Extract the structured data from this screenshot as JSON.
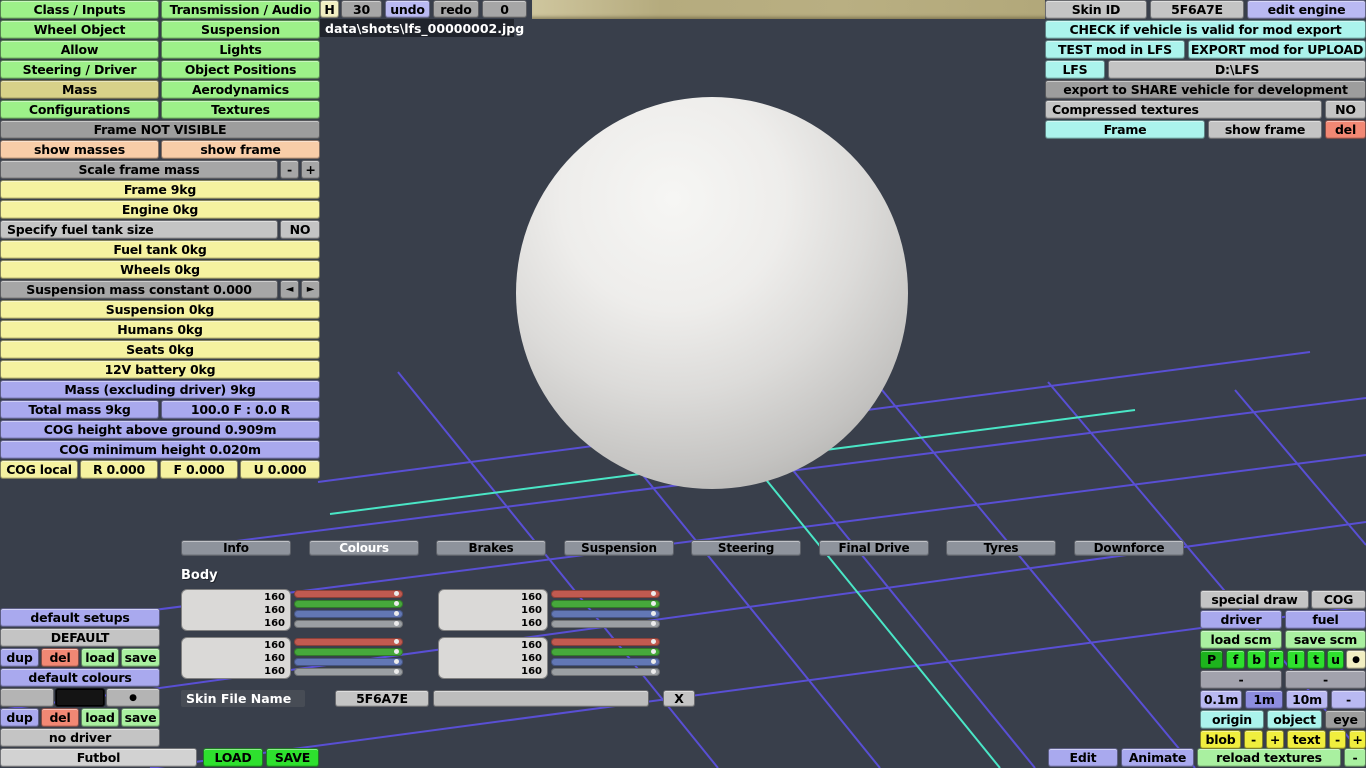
{
  "colors": {
    "background": "#393f4b",
    "menu_green": "#9df189",
    "selected_tan": "#d8d189",
    "panel_yellow": "#f5f2a0",
    "panel_lavender": "#a9a9ee",
    "panel_cyan": "#abf3ec",
    "grid_blue": "#5b50dc",
    "grid_cyan": "#4ae6c6",
    "slider_red": "#c15a50",
    "slider_green": "#46a83b",
    "slider_blue": "#6277b5"
  },
  "left_menu": {
    "items": [
      "Class / Inputs",
      "Transmission / Audio",
      "Wheel Object",
      "Suspension",
      "Allow",
      "Lights",
      "Steering / Driver",
      "Object Positions",
      "Mass",
      "Aerodynamics",
      "Configurations",
      "Textures"
    ],
    "selected": "Mass"
  },
  "frame_section": {
    "status": "Frame NOT VISIBLE",
    "show_masses": "show masses",
    "show_frame": "show frame"
  },
  "mass_panel": {
    "scale_frame_mass": "Scale frame mass",
    "minus": "-",
    "plus": "+",
    "frame": "Frame 9kg",
    "engine": "Engine 0kg",
    "specify_fuel_tank": "Specify fuel tank size",
    "specify_fuel_tank_value": "NO",
    "fuel_tank": "Fuel tank 0kg",
    "wheels": "Wheels 0kg",
    "susp_constant": "Suspension mass constant 0.000",
    "arrow_left": "◄",
    "arrow_right": "►",
    "suspension": "Suspension 0kg",
    "humans": "Humans 0kg",
    "seats": "Seats 0kg",
    "battery": "12V battery 0kg",
    "mass_excl_driver": "Mass (excluding driver) 9kg",
    "total_mass": "Total mass 9kg",
    "front_rear": "100.0 F : 0.0 R",
    "cog_height": "COG height above ground 0.909m",
    "cog_min": "COG minimum height 0.020m",
    "cog_local": "COG local",
    "cog_r": "R 0.000",
    "cog_f": "F 0.000",
    "cog_u": "U 0.000"
  },
  "toolbar": {
    "h": "H",
    "h_value": "30",
    "undo": "undo",
    "redo": "redo",
    "counter": "0"
  },
  "shot_path": "data\\shots\\lfs_00000002.jpg",
  "export_panel": {
    "skin_id_label": "Skin ID",
    "skin_id_value": "5F6A7E",
    "edit_engine": "edit engine",
    "check": "CHECK if vehicle is valid for mod export",
    "test": "TEST mod in LFS",
    "export_upload": "EXPORT mod for UPLOAD",
    "lfs": "LFS",
    "lfs_path": "D:\\LFS",
    "share": "export to SHARE vehicle for development",
    "compressed": "Compressed textures",
    "compressed_value": "NO",
    "frame": "Frame",
    "show_frame": "show frame",
    "del": "del"
  },
  "tabs": {
    "items": [
      "Info",
      "Colours",
      "Brakes",
      "Suspension",
      "Steering",
      "Final Drive",
      "Tyres",
      "Downforce"
    ],
    "selected": "Colours"
  },
  "colours_section": {
    "title": "Body",
    "groups": [
      {
        "r": "160",
        "g": "160",
        "b": "160"
      },
      {
        "r": "160",
        "g": "160",
        "b": "160"
      },
      {
        "r": "160",
        "g": "160",
        "b": "160"
      },
      {
        "r": "160",
        "g": "160",
        "b": "160"
      }
    ]
  },
  "skin_file": {
    "label": "Skin File Name",
    "value": "5F6A7E",
    "clear": "X"
  },
  "setups_panel": {
    "default_setups": "default setups",
    "preset": "DEFAULT",
    "dup": "dup",
    "del": "del",
    "load": "load",
    "save": "save",
    "default_colours": "default colours",
    "dot": "●",
    "no_driver": "no driver"
  },
  "bottom_bar": {
    "vehicle": "Futbol",
    "load": "LOAD",
    "save": "SAVE",
    "edit": "Edit",
    "animate": "Animate",
    "reload_textures": "reload textures",
    "minus": "-"
  },
  "view_panel": {
    "special_draw": "special draw",
    "cog": "COG",
    "driver": "driver",
    "fuel": "fuel",
    "load_scm": "load scm",
    "save_scm": "save scm",
    "letters": [
      "P",
      "f",
      "b",
      "r",
      "l",
      "t",
      "u"
    ],
    "dot": "●",
    "dash": "-",
    "scales": [
      "0.1m",
      "1m",
      "10m",
      "-"
    ],
    "scale_selected": "1m",
    "origin": "origin",
    "object": "object",
    "eye": "eye",
    "blob": "blob",
    "minus": "-",
    "plus": "+",
    "text": "text"
  }
}
